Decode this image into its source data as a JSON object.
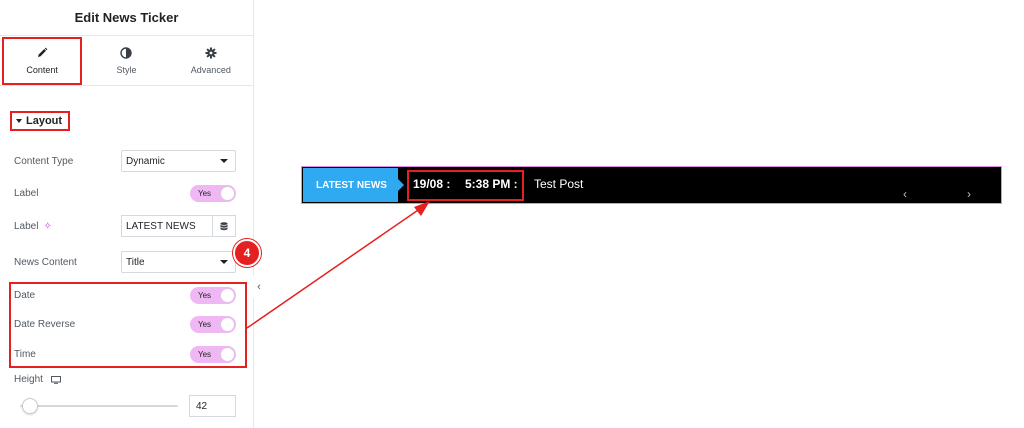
{
  "panel": {
    "title": "Edit News Ticker",
    "tabs": [
      {
        "label": "Content",
        "icon": "pencil-icon"
      },
      {
        "label": "Style",
        "icon": "half-circle-icon"
      },
      {
        "label": "Advanced",
        "icon": "gear-icon"
      }
    ],
    "section": "Layout",
    "fields": {
      "content_type": {
        "label": "Content Type",
        "value": "Dynamic"
      },
      "label_toggle": {
        "label": "Label",
        "value": "Yes"
      },
      "label_text": {
        "label": "Label",
        "value": "LATEST NEWS"
      },
      "news_content": {
        "label": "News Content",
        "value": "Title"
      },
      "date": {
        "label": "Date",
        "value": "Yes"
      },
      "date_reverse": {
        "label": "Date Reverse",
        "value": "Yes"
      },
      "time": {
        "label": "Time",
        "value": "Yes"
      },
      "height": {
        "label": "Height",
        "value": "42"
      }
    }
  },
  "annotation": {
    "step": "4"
  },
  "ticker": {
    "label": "LATEST NEWS",
    "date": "19/08 :",
    "time": "5:38 PM :",
    "title": "Test Post",
    "prev": "‹",
    "next": "›"
  },
  "colors": {
    "highlight": "#e52020",
    "toggle_on": "#f0b7f5",
    "ticker_label_bg": "#2fa9f0",
    "ticker_bg": "#000000",
    "frame_border": "#e38be8"
  }
}
